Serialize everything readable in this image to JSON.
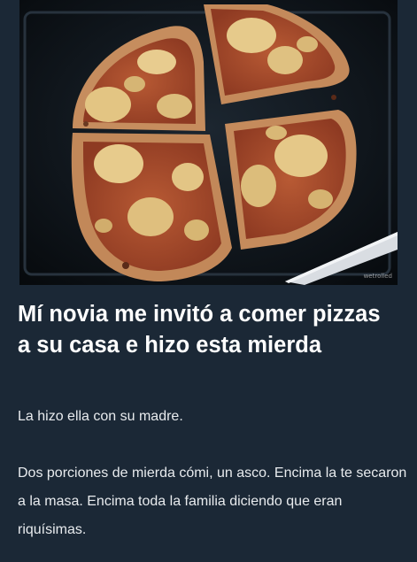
{
  "post": {
    "title": "Mí novia me invitó a comer pizzas a su casa e hizo esta mierda",
    "paragraph_1": "La hizo ella con su madre.",
    "paragraph_2": "Dos porciones de mierda cómi, un asco. Encima la te secaron a la masa. Encima toda la familia diciendo que eran riquísimas."
  },
  "image": {
    "subject": "homemade pizza cut in four slices on a dark baking tray",
    "watermark": "wetrolled"
  },
  "colors": {
    "background": "#1b2836",
    "title_text": "#ffffff",
    "body_text": "#e8ebee",
    "tray": "#0f151c",
    "crust": "#c98f62",
    "sauce": "#a8452a",
    "cheese": "#e6c98a"
  }
}
